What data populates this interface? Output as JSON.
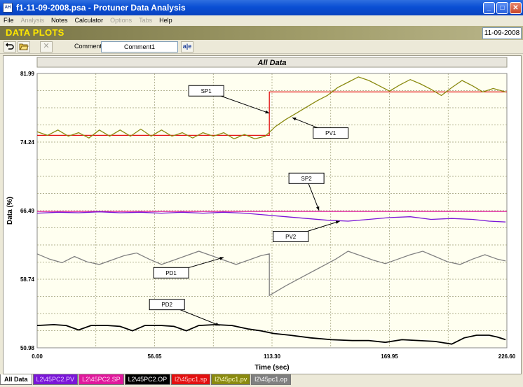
{
  "window": {
    "title": "f1-11-09-2008.psa - Protuner Data  Analysis",
    "app_icon_text": "AH",
    "minimize": "_",
    "maximize": "□",
    "close": "✕"
  },
  "menu": {
    "items": [
      "File",
      "Analysis",
      "Notes",
      "Calculator",
      "Options",
      "Tabs",
      "Help"
    ],
    "disabled": [
      "Analysis",
      "Options",
      "Tabs"
    ]
  },
  "header": {
    "title": "DATA PLOTS",
    "date": "11-09-2008"
  },
  "toolbar": {
    "undo_icon": "undo-icon",
    "open_icon": "folder-open-icon",
    "delete_icon": "delete-x-icon",
    "comment_label": "Comment",
    "comment_value": "Comment1",
    "format_icon": "text-format-icon",
    "format_glyph": "a|e"
  },
  "bottom_tabs": [
    {
      "label": "All Data",
      "bg": "#ffffff",
      "fg": "#000000"
    },
    {
      "label": "L2\\45PC2.PV",
      "bg": "#7a16d8",
      "fg": "#e6c8ff"
    },
    {
      "label": "L2\\45PC2.SP",
      "bg": "#e0189c",
      "fg": "#ffd6f0"
    },
    {
      "label": "L2\\45PC2.OP",
      "bg": "#000000",
      "fg": "#ffffff"
    },
    {
      "label": "l2\\45pc1.sp",
      "bg": "#e31010",
      "fg": "#ffd0d0"
    },
    {
      "label": "l2\\45pc1.pv",
      "bg": "#8a8a10",
      "fg": "#ffffc8"
    },
    {
      "label": "l2\\45pc1.op",
      "bg": "#808080",
      "fg": "#ffffff"
    }
  ],
  "chart_data": {
    "type": "line",
    "title": "All Data",
    "xlabel": "Time (sec)",
    "ylabel": "Data (%)",
    "xlim": [
      0,
      226.6
    ],
    "ylim": [
      50.98,
      81.99
    ],
    "x_ticks": [
      "0.00",
      "56.65",
      "113.30",
      "169.95",
      "226.60"
    ],
    "y_ticks": [
      "81.99",
      "74.24",
      "66.49",
      "58.74",
      "50.98"
    ],
    "grid": true,
    "series": [
      {
        "name": "SP1",
        "color": "#e31010",
        "points": [
          [
            0,
            75.0
          ],
          [
            112,
            75.0
          ],
          [
            112,
            79.9
          ],
          [
            226.6,
            79.9
          ]
        ]
      },
      {
        "name": "PV1",
        "color": "#8a8a10",
        "points": [
          [
            0,
            75.4
          ],
          [
            5,
            75.0
          ],
          [
            10,
            75.6
          ],
          [
            15,
            74.9
          ],
          [
            20,
            75.3
          ],
          [
            25,
            74.7
          ],
          [
            30,
            75.6
          ],
          [
            35,
            74.9
          ],
          [
            40,
            75.6
          ],
          [
            45,
            74.9
          ],
          [
            50,
            75.7
          ],
          [
            55,
            74.9
          ],
          [
            60,
            75.6
          ],
          [
            65,
            74.9
          ],
          [
            70,
            75.3
          ],
          [
            75,
            74.7
          ],
          [
            80,
            75.3
          ],
          [
            85,
            74.9
          ],
          [
            90,
            75.3
          ],
          [
            95,
            74.6
          ],
          [
            100,
            75.1
          ],
          [
            105,
            74.6
          ],
          [
            110,
            74.9
          ],
          [
            115,
            76.0
          ],
          [
            120,
            76.8
          ],
          [
            125,
            77.5
          ],
          [
            130,
            78.2
          ],
          [
            135,
            78.9
          ],
          [
            140,
            79.5
          ],
          [
            145,
            80.4
          ],
          [
            150,
            81.0
          ],
          [
            155,
            81.6
          ],
          [
            160,
            81.2
          ],
          [
            165,
            80.6
          ],
          [
            170,
            80.0
          ],
          [
            175,
            80.7
          ],
          [
            180,
            81.3
          ],
          [
            185,
            80.8
          ],
          [
            190,
            80.2
          ],
          [
            195,
            79.5
          ],
          [
            200,
            80.4
          ],
          [
            205,
            81.2
          ],
          [
            210,
            80.6
          ],
          [
            215,
            79.9
          ],
          [
            220,
            80.3
          ],
          [
            226,
            79.9
          ]
        ]
      },
      {
        "name": "SP2",
        "color": "#e0189c",
        "points": [
          [
            0,
            66.4
          ],
          [
            226.6,
            66.4
          ]
        ]
      },
      {
        "name": "PV2",
        "color": "#7a16d8",
        "points": [
          [
            0,
            66.2
          ],
          [
            10,
            66.3
          ],
          [
            20,
            66.25
          ],
          [
            30,
            66.35
          ],
          [
            40,
            66.25
          ],
          [
            50,
            66.3
          ],
          [
            60,
            66.2
          ],
          [
            70,
            66.3
          ],
          [
            80,
            66.2
          ],
          [
            90,
            66.3
          ],
          [
            100,
            66.2
          ],
          [
            110,
            66.0
          ],
          [
            120,
            65.8
          ],
          [
            130,
            65.6
          ],
          [
            140,
            65.4
          ],
          [
            150,
            65.3
          ],
          [
            160,
            65.5
          ],
          [
            170,
            65.7
          ],
          [
            180,
            65.8
          ],
          [
            190,
            65.5
          ],
          [
            200,
            65.6
          ],
          [
            210,
            65.5
          ],
          [
            218,
            65.3
          ],
          [
            226,
            65.2
          ]
        ]
      },
      {
        "name": "PD1",
        "color": "#808080",
        "points": [
          [
            0,
            61.6
          ],
          [
            6,
            61.0
          ],
          [
            12,
            60.6
          ],
          [
            18,
            61.3
          ],
          [
            24,
            60.7
          ],
          [
            30,
            60.4
          ],
          [
            36,
            60.9
          ],
          [
            42,
            61.4
          ],
          [
            48,
            61.7
          ],
          [
            54,
            61.0
          ],
          [
            60,
            60.4
          ],
          [
            66,
            60.9
          ],
          [
            72,
            61.4
          ],
          [
            78,
            61.9
          ],
          [
            84,
            61.4
          ],
          [
            90,
            60.9
          ],
          [
            96,
            60.4
          ],
          [
            102,
            60.9
          ],
          [
            108,
            61.4
          ],
          [
            112,
            61.6
          ],
          [
            112,
            56.9
          ],
          [
            120,
            58.0
          ],
          [
            128,
            59.0
          ],
          [
            136,
            60.0
          ],
          [
            144,
            61.0
          ],
          [
            150,
            61.9
          ],
          [
            156,
            61.4
          ],
          [
            162,
            60.9
          ],
          [
            168,
            60.5
          ],
          [
            174,
            61.0
          ],
          [
            180,
            61.5
          ],
          [
            186,
            61.9
          ],
          [
            192,
            61.3
          ],
          [
            198,
            60.7
          ],
          [
            204,
            60.4
          ],
          [
            210,
            61.0
          ],
          [
            216,
            61.5
          ],
          [
            222,
            61.0
          ],
          [
            226,
            60.8
          ]
        ]
      },
      {
        "name": "PD2",
        "color": "#000000",
        "points": [
          [
            0,
            53.5
          ],
          [
            8,
            53.6
          ],
          [
            14,
            53.5
          ],
          [
            20,
            53.0
          ],
          [
            26,
            53.5
          ],
          [
            34,
            53.5
          ],
          [
            40,
            53.4
          ],
          [
            46,
            52.9
          ],
          [
            52,
            53.5
          ],
          [
            60,
            53.5
          ],
          [
            66,
            53.4
          ],
          [
            72,
            52.9
          ],
          [
            78,
            53.5
          ],
          [
            86,
            53.6
          ],
          [
            94,
            53.5
          ],
          [
            102,
            53.1
          ],
          [
            108,
            52.9
          ],
          [
            114,
            52.6
          ],
          [
            122,
            52.4
          ],
          [
            132,
            52.1
          ],
          [
            142,
            51.9
          ],
          [
            152,
            51.8
          ],
          [
            160,
            51.8
          ],
          [
            168,
            51.6
          ],
          [
            176,
            51.9
          ],
          [
            184,
            51.8
          ],
          [
            192,
            51.7
          ],
          [
            200,
            51.4
          ],
          [
            206,
            52.1
          ],
          [
            212,
            52.4
          ],
          [
            218,
            52.4
          ],
          [
            222,
            52.2
          ],
          [
            226,
            51.9
          ]
        ]
      }
    ],
    "annotations": [
      {
        "label": "SP1",
        "x": 112,
        "y": 77.5
      },
      {
        "label": "PV1",
        "x": 123,
        "y": 77.0
      },
      {
        "label": "SP2",
        "x": 136,
        "y": 66.5
      },
      {
        "label": "PV2",
        "x": 146,
        "y": 65.3
      },
      {
        "label": "PD1",
        "x": 90,
        "y": 61.2
      },
      {
        "label": "PD2",
        "x": 88,
        "y": 53.5
      }
    ]
  }
}
